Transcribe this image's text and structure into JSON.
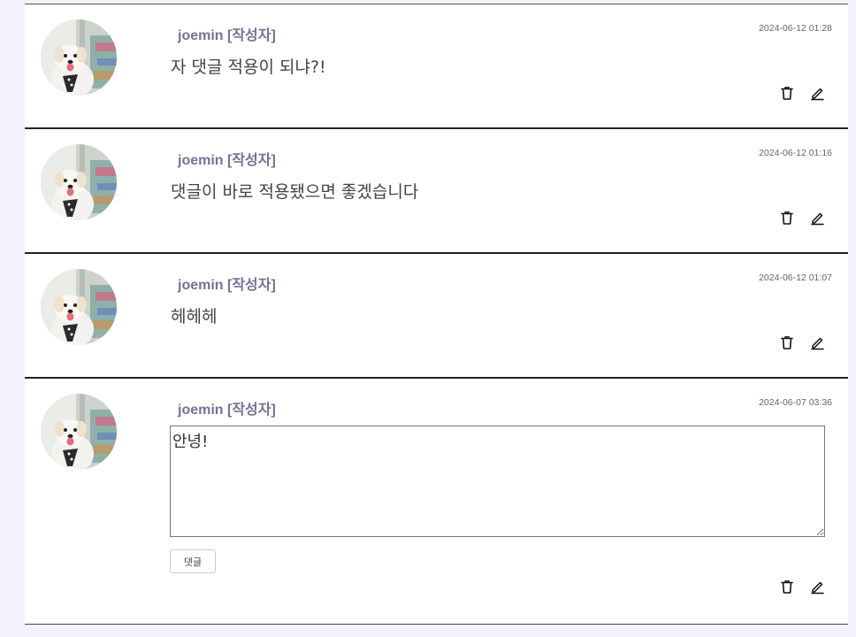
{
  "comments": [
    {
      "author": "joemin [작성자]",
      "date": "2024-06-12 01:28",
      "text": "자 댓글 적용이 되냐?!"
    },
    {
      "author": "joemin [작성자]",
      "date": "2024-06-12 01:16",
      "text": "댓글이 바로 적용됐으면 좋겠습니다"
    },
    {
      "author": "joemin [작성자]",
      "date": "2024-06-12 01:07",
      "text": "헤헤헤"
    },
    {
      "author": "joemin [작성자]",
      "date": "2024-06-07 03:36",
      "edit_value": "안녕!",
      "reply_button": "댓글"
    }
  ],
  "icons": {
    "delete": "trash-icon",
    "edit": "pencil-icon"
  },
  "colors": {
    "author": "#7a6f96",
    "background": "#f3f2fc"
  }
}
